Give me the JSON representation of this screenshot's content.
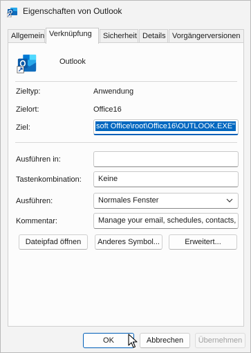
{
  "window": {
    "title": "Eigenschaften von Outlook"
  },
  "tabs": [
    {
      "label": "Allgemein"
    },
    {
      "label": "Verknüpfung"
    },
    {
      "label": "Sicherheit"
    },
    {
      "label": "Details"
    },
    {
      "label": "Vorgängerversionen"
    }
  ],
  "active_tab": "Verknüpfung",
  "app": {
    "name": "Outlook"
  },
  "info": {
    "zieltyp_label": "Zieltyp:",
    "zieltyp_value": "Anwendung",
    "zielort_label": "Zielort:",
    "zielort_value": "Office16"
  },
  "target": {
    "label": "Ziel:",
    "value": "soft Office\\root\\Office16\\OUTLOOK.EXE\""
  },
  "fields": {
    "ausfuehren_in_label": "Ausführen in:",
    "ausfuehren_in_value": "",
    "tastenkombination_label": "Tastenkombination:",
    "tastenkombination_value": "Keine",
    "ausfuehren_label": "Ausführen:",
    "ausfuehren_value": "Normales Fenster",
    "kommentar_label": "Kommentar:",
    "kommentar_value": "Manage your email, schedules, contacts, ar"
  },
  "panel_buttons": {
    "dateipfad": "Dateipfad öffnen",
    "anderes_symbol": "Anderes Symbol...",
    "erweitert": "Erweitert..."
  },
  "dialog_buttons": {
    "ok": "OK",
    "abbrechen": "Abbrechen",
    "uebernehmen": "Übernehmen"
  },
  "colors": {
    "accent": "#005fb8",
    "selection": "#0067c0",
    "outlook_blue": "#0f6cbd"
  },
  "icons": [
    "outlook-shortcut-icon",
    "outlook-app-icon",
    "chevron-down-icon",
    "mouse-cursor-icon"
  ]
}
